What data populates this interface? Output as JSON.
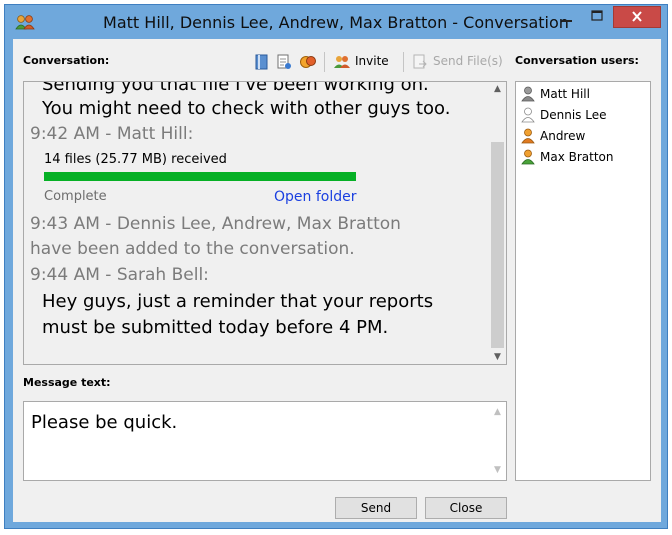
{
  "window": {
    "title": "Matt Hill, Dennis Lee, Andrew, Max Bratton - Conversation",
    "close_glyph": "✕",
    "minimize_glyph": "—",
    "maximize_glyph": "☐"
  },
  "toolbar": {
    "conversation_label": "Conversation:",
    "invite_label": "Invite",
    "send_files_label": "Send File(s)"
  },
  "conversation": {
    "partial_line": "Sending you that file I've been working on.",
    "line2": "You might need to check with other guys too.",
    "meta1": "9:42 AM - Matt Hill:",
    "file_transfer": {
      "text": "14 files (25.77 MB) received",
      "progress": 1.0,
      "status": "Complete",
      "link": "Open folder"
    },
    "meta2": "9:43 AM - Dennis Lee, Andrew, Max Bratton",
    "meta2b": "have been added to the conversation.",
    "meta3": "9:44 AM - Sarah Bell:",
    "msg3a": "Hey guys, just a reminder that your reports",
    "msg3b": "must be submitted today before 4 PM."
  },
  "message": {
    "label": "Message text:",
    "value": "Please be quick."
  },
  "buttons": {
    "send": "Send",
    "close": "Close"
  },
  "users": {
    "label": "Conversation users:",
    "items": [
      {
        "name": "Matt Hill",
        "icon": "user-gray-icon"
      },
      {
        "name": "Dennis Lee",
        "icon": "user-offline-icon"
      },
      {
        "name": "Andrew",
        "icon": "user-orange-icon"
      },
      {
        "name": "Max Bratton",
        "icon": "user-orange-green-icon"
      }
    ]
  },
  "colors": {
    "progress": "#06b025",
    "link": "#1a3fe0",
    "close_button": "#c94a47"
  }
}
